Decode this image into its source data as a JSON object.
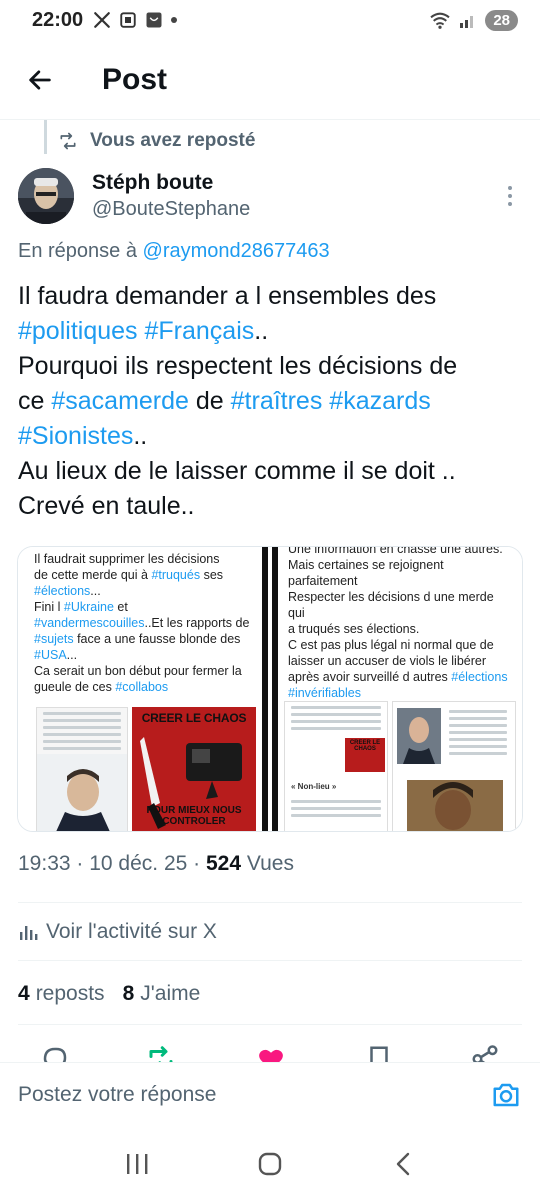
{
  "status_bar": {
    "time": "22:00",
    "battery": "28",
    "icons": [
      "x-logo-icon",
      "screenshot-icon",
      "app-icon",
      "dot-icon",
      "wifi-icon",
      "signal-icon"
    ]
  },
  "header": {
    "title": "Post",
    "back_icon": "arrow-left-icon"
  },
  "repost": {
    "label": "Vous avez reposté"
  },
  "author": {
    "name": "Stéph boute",
    "handle": "@BouteStephane"
  },
  "reply_to": {
    "prefix": "En réponse à",
    "mention": "@raymond28677463"
  },
  "tweet": {
    "lines": [
      [
        {
          "t": "Il faudra demander a l ensembles des"
        }
      ],
      [
        {
          "t": "#politiques",
          "tag": true
        },
        {
          "t": " "
        },
        {
          "t": "#Français",
          "tag": true
        },
        {
          "t": ".."
        }
      ],
      [
        {
          "t": "Pourquoi ils respectent les décisions de"
        }
      ],
      [
        {
          "t": "ce "
        },
        {
          "t": "#sacamerde",
          "tag": true
        },
        {
          "t": " de "
        },
        {
          "t": "#traîtres",
          "tag": true
        },
        {
          "t": " "
        },
        {
          "t": "#kazards",
          "tag": true
        }
      ],
      [
        {
          "t": "#Sionistes",
          "tag": true
        },
        {
          "t": ".."
        }
      ],
      [
        {
          "t": "Au lieux de le laisser comme il se doit .."
        }
      ],
      [
        {
          "t": "Crevé en taule.."
        }
      ]
    ]
  },
  "media": {
    "left_panel_lines": [
      [
        {
          "t": "Il faudrait supprimer les décisions"
        }
      ],
      [
        {
          "t": "de cette merde qui à "
        },
        {
          "t": "#truqués",
          "tag": true
        },
        {
          "t": " ses"
        }
      ],
      [
        {
          "t": "#élections",
          "tag": true
        },
        {
          "t": "..."
        }
      ],
      [
        {
          "t": "Fini l "
        },
        {
          "t": "#Ukraine",
          "tag": true
        },
        {
          "t": " et"
        }
      ],
      [
        {
          "t": "#vandermescouilles",
          "tag": true
        },
        {
          "t": "..Et les rapports de"
        }
      ],
      [
        {
          "t": "#sujets",
          "tag": true
        },
        {
          "t": " face a une fausse blonde des"
        }
      ],
      [
        {
          "t": "#USA",
          "tag": true
        },
        {
          "t": "..."
        }
      ],
      [
        {
          "t": " "
        }
      ],
      [
        {
          "t": "Ca serait un bon début pour fermer la"
        }
      ],
      [
        {
          "t": "gueule de ces "
        },
        {
          "t": "#collabos",
          "tag": true
        }
      ]
    ],
    "left_poster_title": "CREER LE CHAOS",
    "left_poster_sub": "POUR MIEUX NOUS CONTROLER",
    "right_panel_lines": [
      [
        {
          "t": "Une information en chasse une autres."
        }
      ],
      [
        {
          "t": "Mais certaines se rejoignent"
        }
      ],
      [
        {
          "t": "parfaitement"
        }
      ],
      [
        {
          "t": "Respecter les décisions d une merde qui"
        }
      ],
      [
        {
          "t": "a truqués ses élections."
        }
      ],
      [
        {
          "t": "C est pas plus légal ni normal que de"
        }
      ],
      [
        {
          "t": "laisser un accuser de viols le libérer"
        }
      ],
      [
        {
          "t": "après avoir surveillé d autres "
        },
        {
          "t": "#élections",
          "tag": true
        }
      ],
      [
        {
          "t": "#invérifiables",
          "tag": true
        }
      ]
    ],
    "right_mini_title": "CREER LE CHAOS",
    "right_mini_sub": "« Non-lieu »"
  },
  "meta": {
    "time": "19:33",
    "date": "10 déc. 25",
    "views_count": "524",
    "views_label": "Vues"
  },
  "activity": {
    "label": "Voir l'activité sur X",
    "icon": "bar-chart-icon"
  },
  "stats": {
    "reposts_count": "4",
    "reposts_label": "reposts",
    "likes_count": "8",
    "likes_label": "J'aime"
  },
  "actions": [
    "reply-icon",
    "repost-icon",
    "like-icon",
    "bookmark-icon",
    "share-icon"
  ],
  "colors": {
    "accent": "#1d9bf0",
    "repost_green": "#00ba7c",
    "like_pink": "#f91880",
    "muted": "#536471"
  },
  "reply_bar": {
    "placeholder": "Postez votre réponse",
    "icon": "camera-icon"
  },
  "nav_bar": {
    "buttons": [
      "recents-icon",
      "home-icon",
      "back-icon"
    ]
  }
}
